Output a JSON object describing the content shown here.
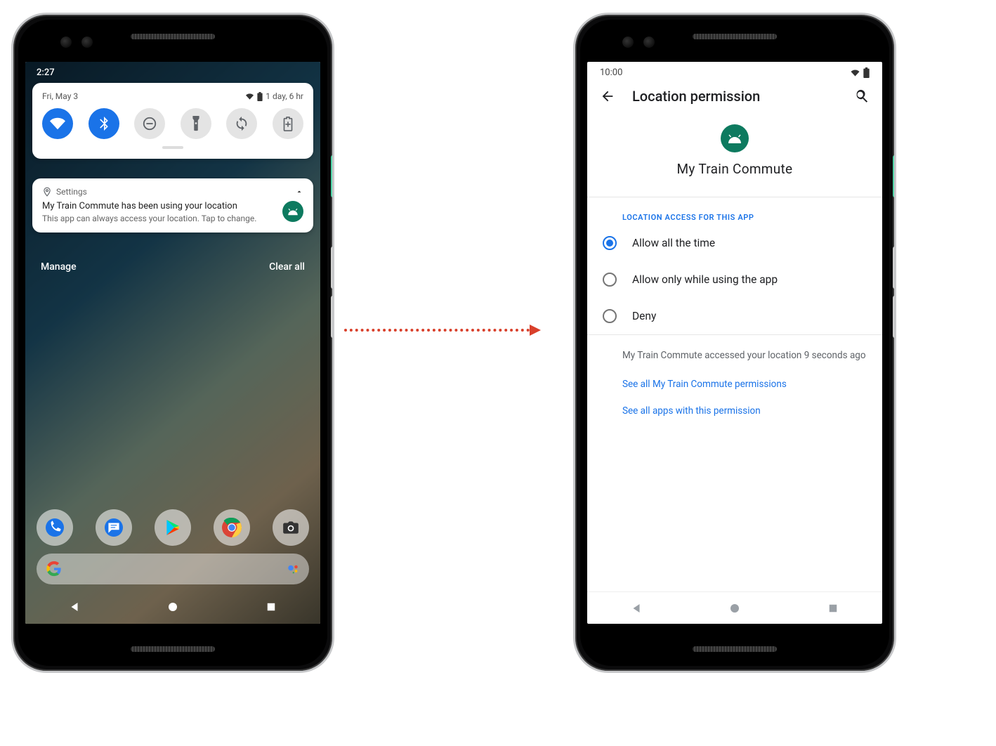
{
  "left": {
    "status_time": "2:27",
    "qs_date": "Fri, May 3",
    "qs_battery_text": "1 day, 6 hr",
    "tiles": [
      "wifi",
      "bluetooth",
      "dnd",
      "flashlight",
      "rotate",
      "battery-saver"
    ],
    "tiles_active": [
      true,
      true,
      false,
      false,
      false,
      false
    ],
    "notification": {
      "app_label": "Settings",
      "title": "My Train Commute has been using your location",
      "subtitle": "This app can always access your location. Tap to change."
    },
    "actions": {
      "manage": "Manage",
      "clear": "Clear all"
    },
    "dock_apps": [
      "phone",
      "messages",
      "play-store",
      "chrome",
      "camera"
    ]
  },
  "right": {
    "status_time": "10:00",
    "appbar_title": "Location permission",
    "app_name": "My Train Commute",
    "section_label": "LOCATION ACCESS FOR THIS APP",
    "options": [
      "Allow all the time",
      "Allow only while using the app",
      "Deny"
    ],
    "selected_index": 0,
    "info_text": "My Train Commute accessed your location 9 seconds ago",
    "link_app_perms": "See all My Train Commute permissions",
    "link_all_apps": "See all apps with this permission"
  }
}
